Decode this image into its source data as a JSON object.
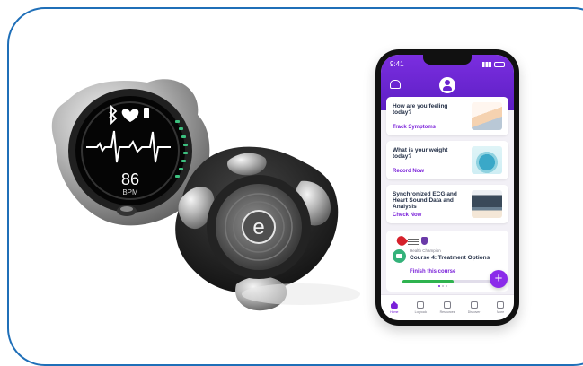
{
  "phone": {
    "status_time": "9:41",
    "cards": [
      {
        "question": "How are you feeling today?",
        "action": "Track Symptoms",
        "image": "notebook-image"
      },
      {
        "question": "What is your weight today?",
        "action": "Record Now",
        "image": "scale-image"
      },
      {
        "question": "Synchronized ECG and Heart Sound Data and Analysis",
        "action": "Check Now",
        "image": "laptop-image"
      }
    ],
    "course": {
      "champion": "Health Champion",
      "title": "Course 4: Treatment Options",
      "cta": "Finish this course",
      "progress": 0.58
    },
    "fab_symbol": "+",
    "nav": [
      {
        "label": "Home",
        "icon": "home-icon"
      },
      {
        "label": "Logbook",
        "icon": "book-icon"
      },
      {
        "label": "Resources",
        "icon": "bulb-icon"
      },
      {
        "label": "Discover",
        "icon": "compass-icon"
      },
      {
        "label": "More",
        "icon": "more-icon"
      }
    ]
  },
  "device": {
    "heart_rate": "86",
    "unit": "BPM",
    "logo_letter": "e"
  },
  "colors": {
    "accent": "#7a20d9",
    "border": "#1f6fb8",
    "ecg_green": "#3cc07f"
  }
}
